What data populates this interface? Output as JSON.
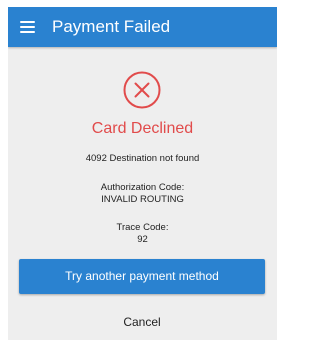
{
  "app_bar": {
    "title": "Payment Failed",
    "menu_icon": "hamburger-menu-icon",
    "color": "#2a82d0"
  },
  "status": {
    "icon": "error-circle-x-icon",
    "icon_color": "#e14b4b",
    "title": "Card Declined",
    "message": "4092 Destination not found"
  },
  "details": {
    "authorization_label": "Authorization Code:",
    "authorization_value": "INVALID ROUTING",
    "trace_label": "Trace Code:",
    "trace_value": "92"
  },
  "actions": {
    "primary_label": "Try another payment method",
    "secondary_label": "Cancel"
  },
  "colors": {
    "background": "#eeeeee",
    "accent": "#2a82d0",
    "error": "#e14b4b"
  }
}
